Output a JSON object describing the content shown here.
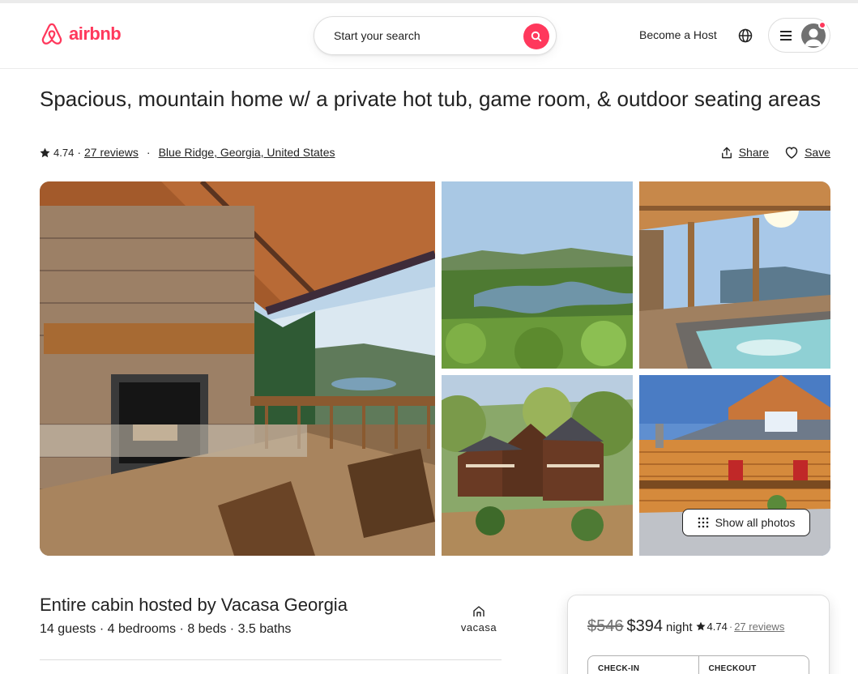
{
  "header": {
    "logo_text": "airbnb",
    "search_placeholder": "Start your search",
    "become_host": "Become a Host",
    "icons": [
      "airbnb-logo-icon",
      "search-icon",
      "globe-icon",
      "hamburger-menu-icon",
      "user-avatar-icon"
    ]
  },
  "listing": {
    "title": "Spacious, mountain home w/ a private hot tub, game room, & outdoor seating areas",
    "rating": "4.74",
    "separator": "·",
    "reviews": "27 reviews",
    "location": "Blue Ridge, Georgia, United States",
    "share_label": "Share",
    "save_label": "Save"
  },
  "gallery": {
    "show_all_label": "Show all photos",
    "photos": [
      "outdoor stone fireplace on covered deck with lake view",
      "aerial view of mountain lake",
      "covered hot tub on deck",
      "aerial view of cabin in woods",
      "log cabin exterior"
    ]
  },
  "host_section": {
    "heading": "Entire cabin hosted by Vacasa Georgia",
    "details": "14 guests · 4 bedrooms · 8 beds · 3.5 baths",
    "host_logo_text": "vacasa"
  },
  "booking": {
    "old_price": "$546",
    "price": "$394",
    "per": "night",
    "rating": "4.74",
    "separator": "·",
    "reviews": "27 reviews",
    "checkin_label": "CHECK-IN",
    "checkout_label": "CHECKOUT"
  },
  "colors": {
    "brand": "#ff385c",
    "text": "#222222",
    "muted": "#717171",
    "border": "#dddddd"
  }
}
